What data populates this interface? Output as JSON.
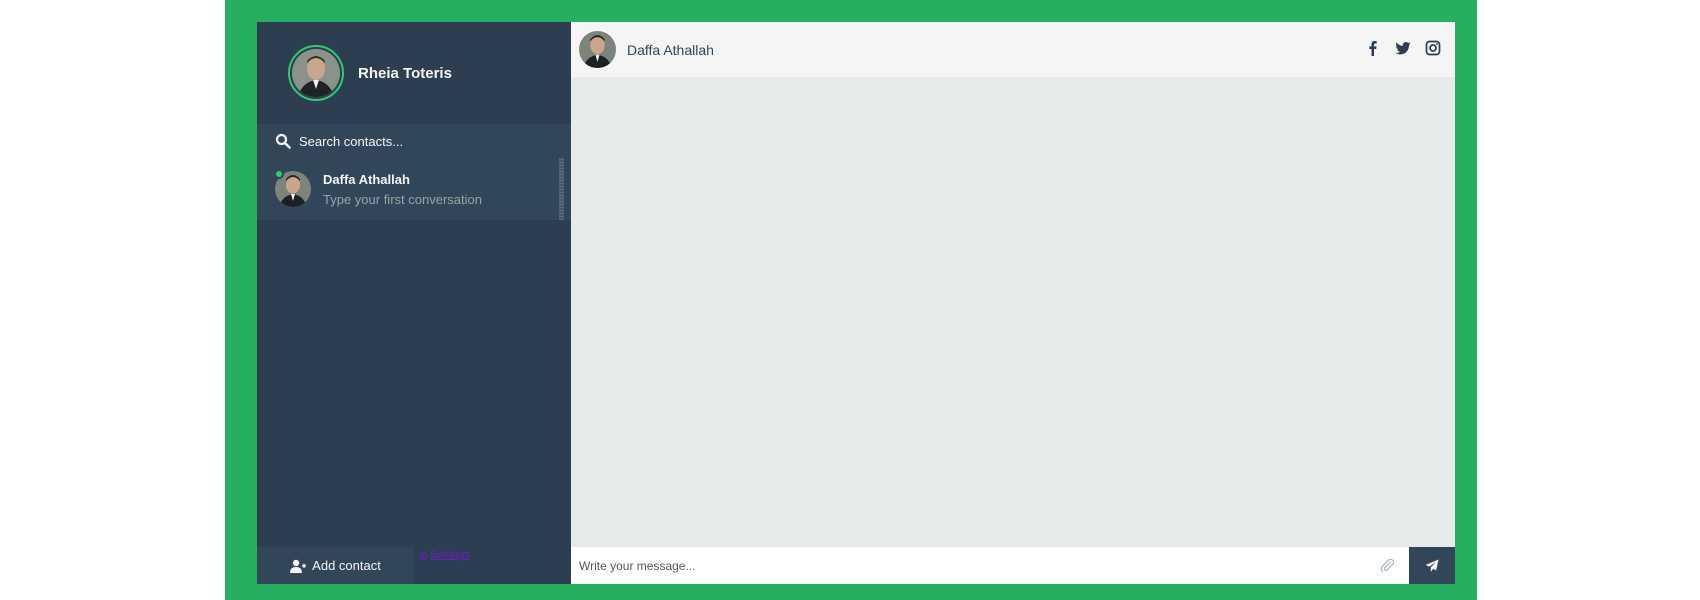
{
  "user": {
    "name": "Rheia Toteris"
  },
  "search": {
    "placeholder": "Search contacts..."
  },
  "contacts": [
    {
      "name": "Daffa Athallah",
      "preview": "Type your first conversation",
      "status": "online"
    }
  ],
  "sidebar_bottom": {
    "add_contact_label": "Add contact",
    "settings_label": "Settings"
  },
  "chat": {
    "contact_name": "Daffa Athallah",
    "social_icons": [
      "facebook-icon",
      "twitter-icon",
      "instagram-icon"
    ],
    "composer_placeholder": "Write your message..."
  },
  "colors": {
    "frame": "#27ae60",
    "sidebar": "#2c3e50",
    "sidebar_highlight": "#32465a",
    "online": "#2ecc71",
    "chat_background": "#e6eaea"
  }
}
